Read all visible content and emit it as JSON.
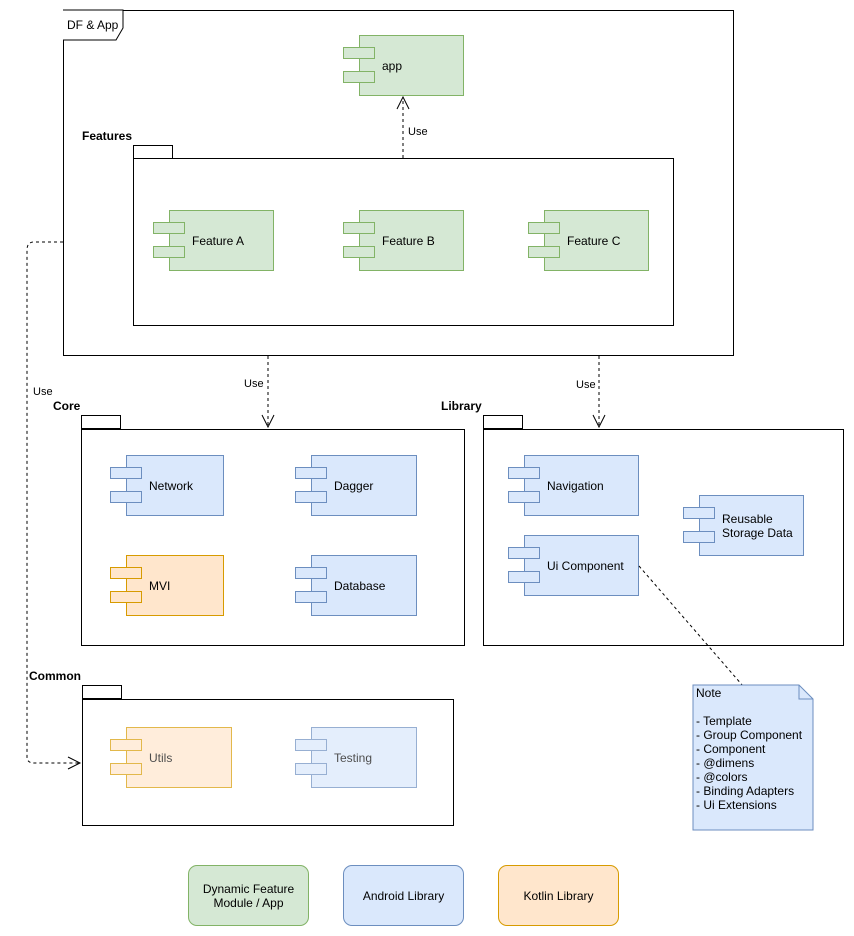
{
  "frame": {
    "title": "DF & App"
  },
  "app": {
    "label": "app"
  },
  "features": {
    "title": "Features",
    "items": [
      {
        "label": "Feature A"
      },
      {
        "label": "Feature B"
      },
      {
        "label": "Feature C"
      }
    ]
  },
  "core": {
    "title": "Core",
    "items": [
      {
        "label": "Network",
        "type": "android"
      },
      {
        "label": "Dagger",
        "type": "android"
      },
      {
        "label": "MVI",
        "type": "kotlin"
      },
      {
        "label": "Database",
        "type": "android"
      }
    ]
  },
  "library": {
    "title": "Library",
    "items": [
      {
        "label": "Navigation",
        "type": "android"
      },
      {
        "label": "Reusable Storage Data",
        "type": "android"
      },
      {
        "label": "Ui Component",
        "type": "android"
      }
    ]
  },
  "common": {
    "title": "Common",
    "items": [
      {
        "label": "Utils",
        "type": "kotlin"
      },
      {
        "label": "Testing",
        "type": "android"
      }
    ]
  },
  "edges": {
    "features_to_app": "Use",
    "app_to_core": "Use",
    "app_to_library": "Use",
    "app_to_common": "Use"
  },
  "note": {
    "title": "Note",
    "lines": [
      "- Template",
      "- Group Component",
      "- Component",
      "- @dimens",
      "- @colors",
      "- Binding Adapters",
      "- Ui Extensions"
    ]
  },
  "legend": {
    "items": [
      {
        "label": "Dynamic Feature Module / App",
        "color": "#d5e8d4",
        "stroke": "#82b366"
      },
      {
        "label": "Android Library",
        "color": "#dae8fc",
        "stroke": "#6c8ebf"
      },
      {
        "label": "Kotlin Library",
        "color": "#ffe6cc",
        "stroke": "#d79b00"
      }
    ]
  },
  "colors": {
    "dynamic_feature": "#d5e8d4",
    "android_library": "#dae8fc",
    "kotlin_library": "#ffe6cc"
  }
}
